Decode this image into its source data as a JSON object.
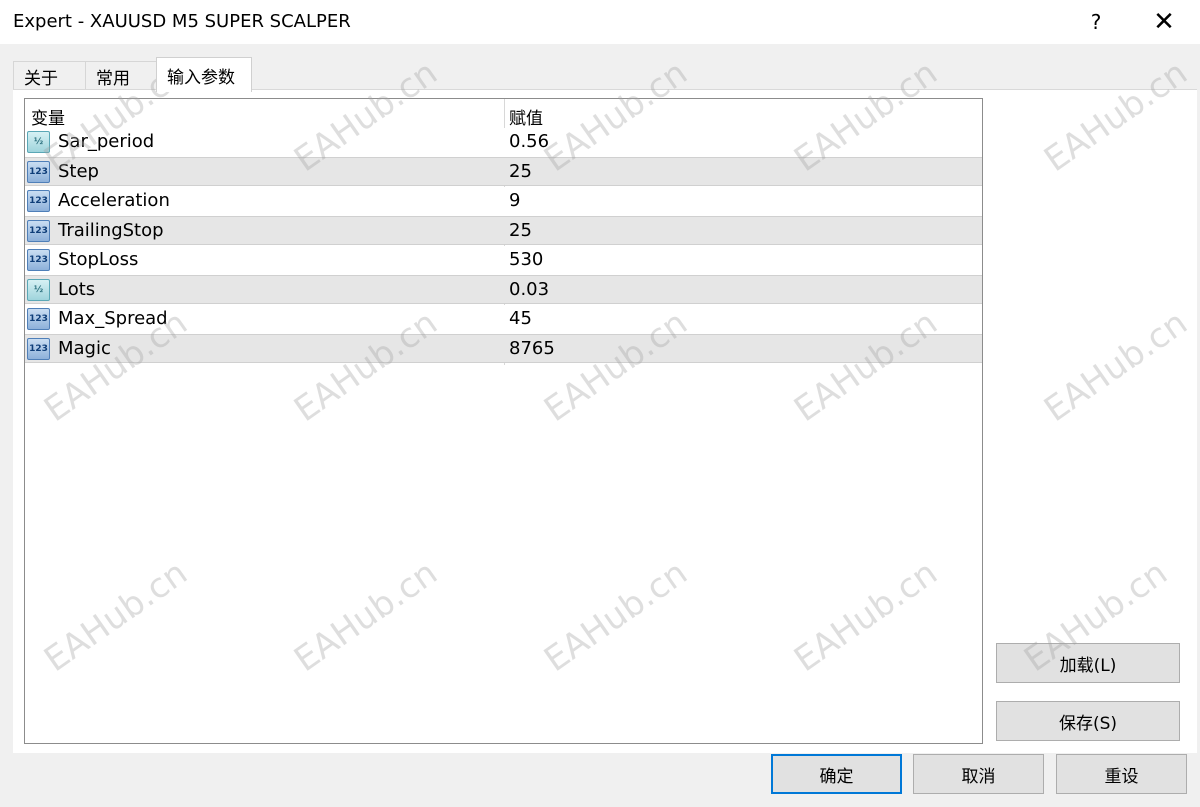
{
  "window": {
    "title": "Expert - XAUUSD M5 SUPER SCALPER",
    "help": "?",
    "close": "✕"
  },
  "tabs": [
    {
      "label": "关于"
    },
    {
      "label": "常用"
    },
    {
      "label": "输入参数",
      "active": true
    }
  ],
  "table": {
    "headers": {
      "variable": "变量",
      "value": "赋值"
    },
    "rows": [
      {
        "icon": "double-type-icon",
        "icon_text": "½",
        "name": "Sar_period",
        "value": "0.56"
      },
      {
        "icon": "integer-type-icon",
        "icon_text": "123",
        "name": "Step",
        "value": "25"
      },
      {
        "icon": "integer-type-icon",
        "icon_text": "123",
        "name": "Acceleration",
        "value": "9"
      },
      {
        "icon": "integer-type-icon",
        "icon_text": "123",
        "name": "TrailingStop",
        "value": "25"
      },
      {
        "icon": "integer-type-icon",
        "icon_text": "123",
        "name": "StopLoss",
        "value": "530"
      },
      {
        "icon": "double-type-icon",
        "icon_text": "½",
        "name": "Lots",
        "value": "0.03"
      },
      {
        "icon": "integer-type-icon",
        "icon_text": "123",
        "name": "Max_Spread",
        "value": "45"
      },
      {
        "icon": "integer-type-icon",
        "icon_text": "123",
        "name": "Magic",
        "value": "8765"
      }
    ]
  },
  "buttons": {
    "load": "加载(L)",
    "save": "保存(S)",
    "ok": "确定",
    "cancel": "取消",
    "reset": "重设"
  },
  "watermark": "EAHub.cn",
  "colors": {
    "ok_border": "#0078d7",
    "alt_row": "#e6e6e6"
  }
}
